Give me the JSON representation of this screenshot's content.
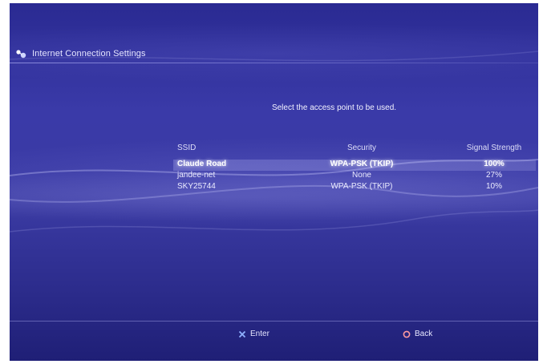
{
  "header": {
    "title": "Internet Connection Settings"
  },
  "prompt": "Select the access point to be used.",
  "columns": {
    "ssid": "SSID",
    "security": "Security",
    "signal": "Signal Strength"
  },
  "access_points": [
    {
      "ssid": "Claude Road",
      "security": "WPA-PSK (TKIP)",
      "signal": "100%"
    },
    {
      "ssid": "jandee-net",
      "security": "None",
      "signal": "27%"
    },
    {
      "ssid": "SKY25744",
      "security": "WPA-PSK (TKIP)",
      "signal": "10%"
    }
  ],
  "footer": {
    "enter_label": "Enter",
    "back_label": "Back"
  },
  "colors": {
    "background": "#3a3aa8",
    "cross": "#8fb0ff",
    "circle": "#ff9aa0"
  },
  "icons": {
    "header": "network-settings-icon",
    "enter": "cross-button-icon",
    "back": "circle-button-icon"
  }
}
